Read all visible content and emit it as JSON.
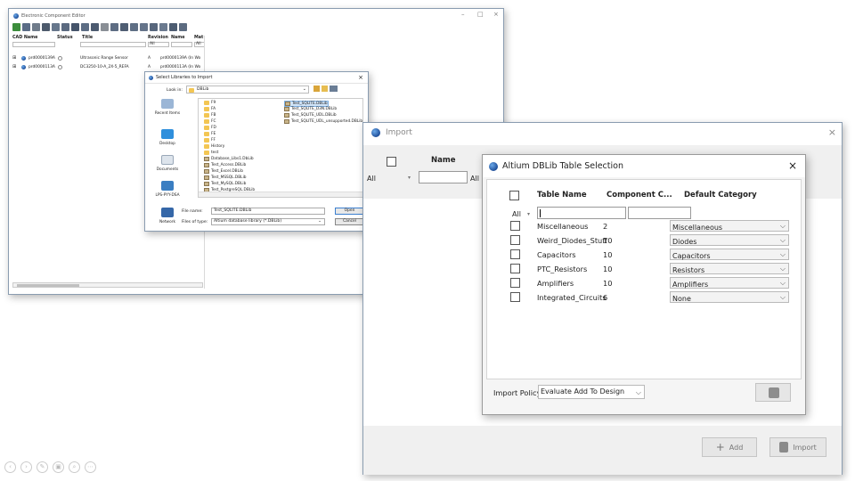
{
  "main_window": {
    "title": "Electronic Component Editor",
    "controls": [
      "–",
      "□",
      "×"
    ],
    "columns": {
      "cad_name": "CAD Name",
      "status": "Status",
      "title": "Title",
      "revision": "Revision",
      "name": "Name",
      "mat": "Mat"
    },
    "filter_values": {
      "revision": "All",
      "mat": "All"
    },
    "rows": [
      {
        "cad": "prd0000139A",
        "title": "Ultrasonic Range Sensor",
        "rev": "A",
        "name": "prd0000139A (In Wo"
      },
      {
        "cad": "prd0000113A",
        "title": "DC3250-10-A_2X-5_REFA",
        "rev": "A",
        "name": "prd0000113A (In Wo"
      }
    ]
  },
  "select_dialog": {
    "title": "Select Libraries to Import",
    "look_in_label": "Look in:",
    "look_in_value": "DBLib",
    "places": [
      "Recent Items",
      "Desktop",
      "Documents",
      "LPS-PYY-DSA",
      "Network"
    ],
    "folders": [
      "F9",
      "FA",
      "FB",
      "FC",
      "FD",
      "FE",
      "FF",
      "History",
      "test"
    ],
    "files_left": [
      "Database_Libs1.DbLib",
      "Test_Access.DBLib",
      "Test_Excel.DBLib",
      "Test_MSSQL.DBLib",
      "Test_MySQL.DBLib",
      "Test_PostgreSQL.DBLib"
    ],
    "files_right": [
      "Test_SQLITE.DBLib",
      "Test_SQLITE_D3N.DBLib",
      "Test_SQLITE_UDL.DBLib",
      "Test_SQLITE_UDL_unsupported.DBLib"
    ],
    "file_name_label": "File name:",
    "file_name_value": "Test_SQLITE.DBLib",
    "file_type_label": "Files of type:",
    "file_type_value": "Altium database library (*.DBLib)",
    "open_button": "Open",
    "cancel_button": "Cancel"
  },
  "import_window": {
    "title": "Import",
    "column_name": "Name",
    "filter_all": "All",
    "filter_all_2": "All",
    "add_button": "Add",
    "import_button": "Import"
  },
  "altium_dialog": {
    "title": "Altium DBLib Table Selection",
    "headers": {
      "table_name": "Table Name",
      "component_count": "Component C...",
      "default_category": "Default Category"
    },
    "filter_all": "All",
    "rows": [
      {
        "table": "Miscellaneous",
        "count": "2",
        "category": "Miscellaneous"
      },
      {
        "table": "Weird_Diodes_Stuff",
        "count": "10",
        "category": "Diodes"
      },
      {
        "table": "Capacitors",
        "count": "10",
        "category": "Capacitors"
      },
      {
        "table": "PTC_Resistors",
        "count": "10",
        "category": "Resistors"
      },
      {
        "table": "Amplifiers",
        "count": "10",
        "category": "Amplifiers"
      },
      {
        "table": "Integrated_Circuits",
        "count": "6",
        "category": "None"
      }
    ],
    "import_policy_label": "Import Policy",
    "import_policy_value": "Evaluate Add To Design"
  },
  "colors": {
    "accent_blue": "#1f4f9a",
    "folder": "#f3c653",
    "selection": "#cfe3f7"
  }
}
